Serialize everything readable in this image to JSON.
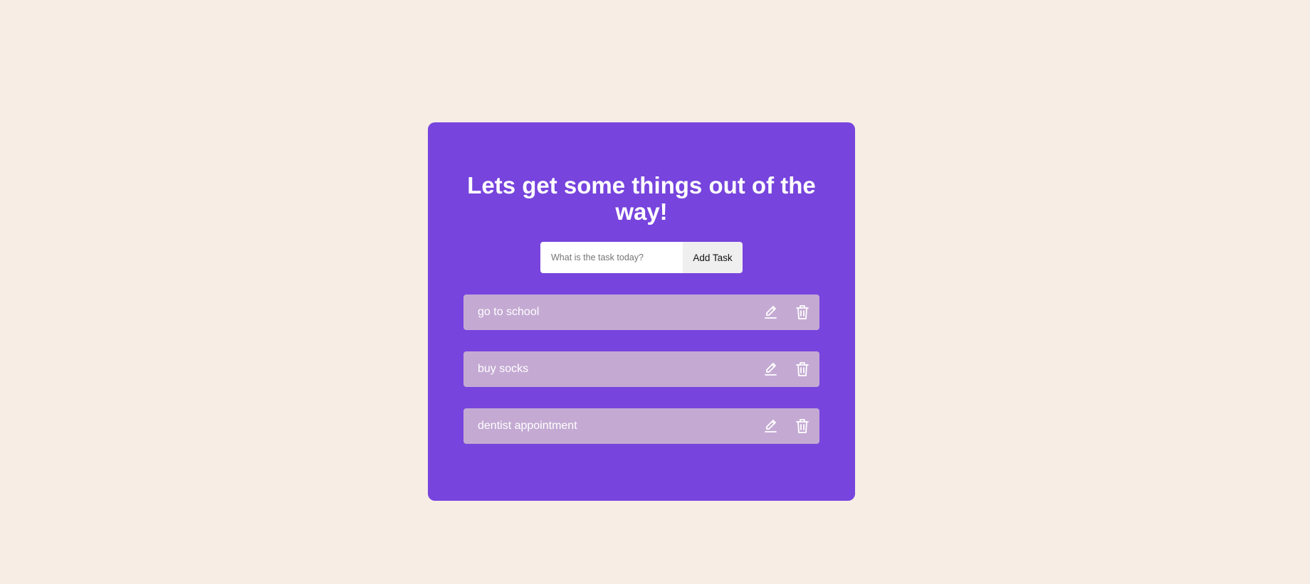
{
  "header": {
    "title": "Lets get some things out of the way!"
  },
  "form": {
    "input_value": "",
    "input_placeholder": "What is the task today?",
    "add_label": "Add Task"
  },
  "tasks": [
    {
      "text": "go to school",
      "edit_icon": "pencil-icon",
      "delete_icon": "trash-icon"
    },
    {
      "text": "buy socks",
      "edit_icon": "pencil-icon",
      "delete_icon": "trash-icon"
    },
    {
      "text": "dentist appointment",
      "edit_icon": "pencil-icon",
      "delete_icon": "trash-icon"
    }
  ],
  "colors": {
    "background": "#f7ede5",
    "card": "#7744dd",
    "task_item": "#c4aad3",
    "text_light": "#ffffff"
  }
}
